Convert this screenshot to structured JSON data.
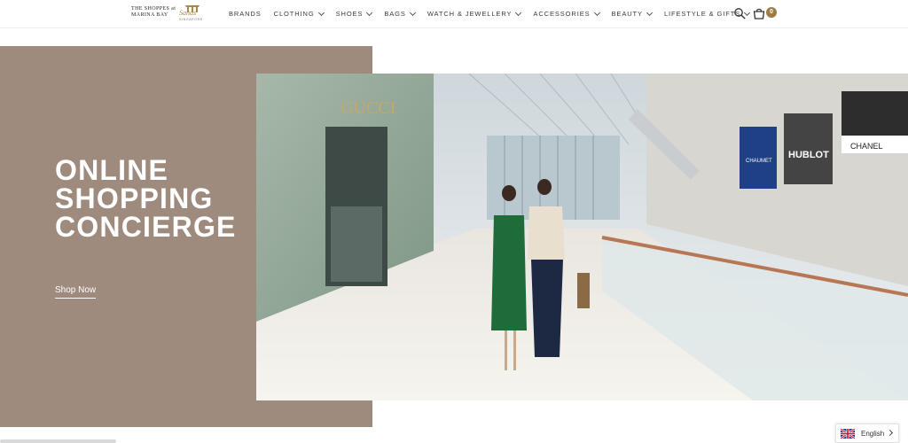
{
  "header": {
    "logo": {
      "line1": "THE SHOPPES at",
      "line2": "MARINA BAY",
      "script": "Sands",
      "sub": "SINGAPORE"
    },
    "nav": [
      {
        "label": "BRANDS",
        "has_dropdown": false
      },
      {
        "label": "CLOTHING",
        "has_dropdown": true
      },
      {
        "label": "SHOES",
        "has_dropdown": true
      },
      {
        "label": "BAGS",
        "has_dropdown": true
      },
      {
        "label": "WATCH & JEWELLERY",
        "has_dropdown": true
      },
      {
        "label": "ACCESSORIES",
        "has_dropdown": true
      },
      {
        "label": "BEAUTY",
        "has_dropdown": true
      },
      {
        "label": "LIFESTYLE & GIFTS",
        "has_dropdown": true
      }
    ],
    "icons": {
      "search": "search-icon",
      "cart": "shopping-bag-icon"
    },
    "cart_count": "0"
  },
  "hero": {
    "title_lines": [
      "ONLINE",
      "SHOPPING",
      "CONCIERGE"
    ],
    "cta": "Shop Now",
    "image_store_sign": "GUCCI",
    "image_signs": [
      "HUBLOT",
      "CHANEL",
      "CHAUMET"
    ]
  },
  "language": {
    "label": "English",
    "flag": "uk-flag-icon"
  },
  "colors": {
    "panel": "#9e8b7e",
    "accent_gold": "#9c7b44",
    "nav_text": "#3a3a3a"
  }
}
